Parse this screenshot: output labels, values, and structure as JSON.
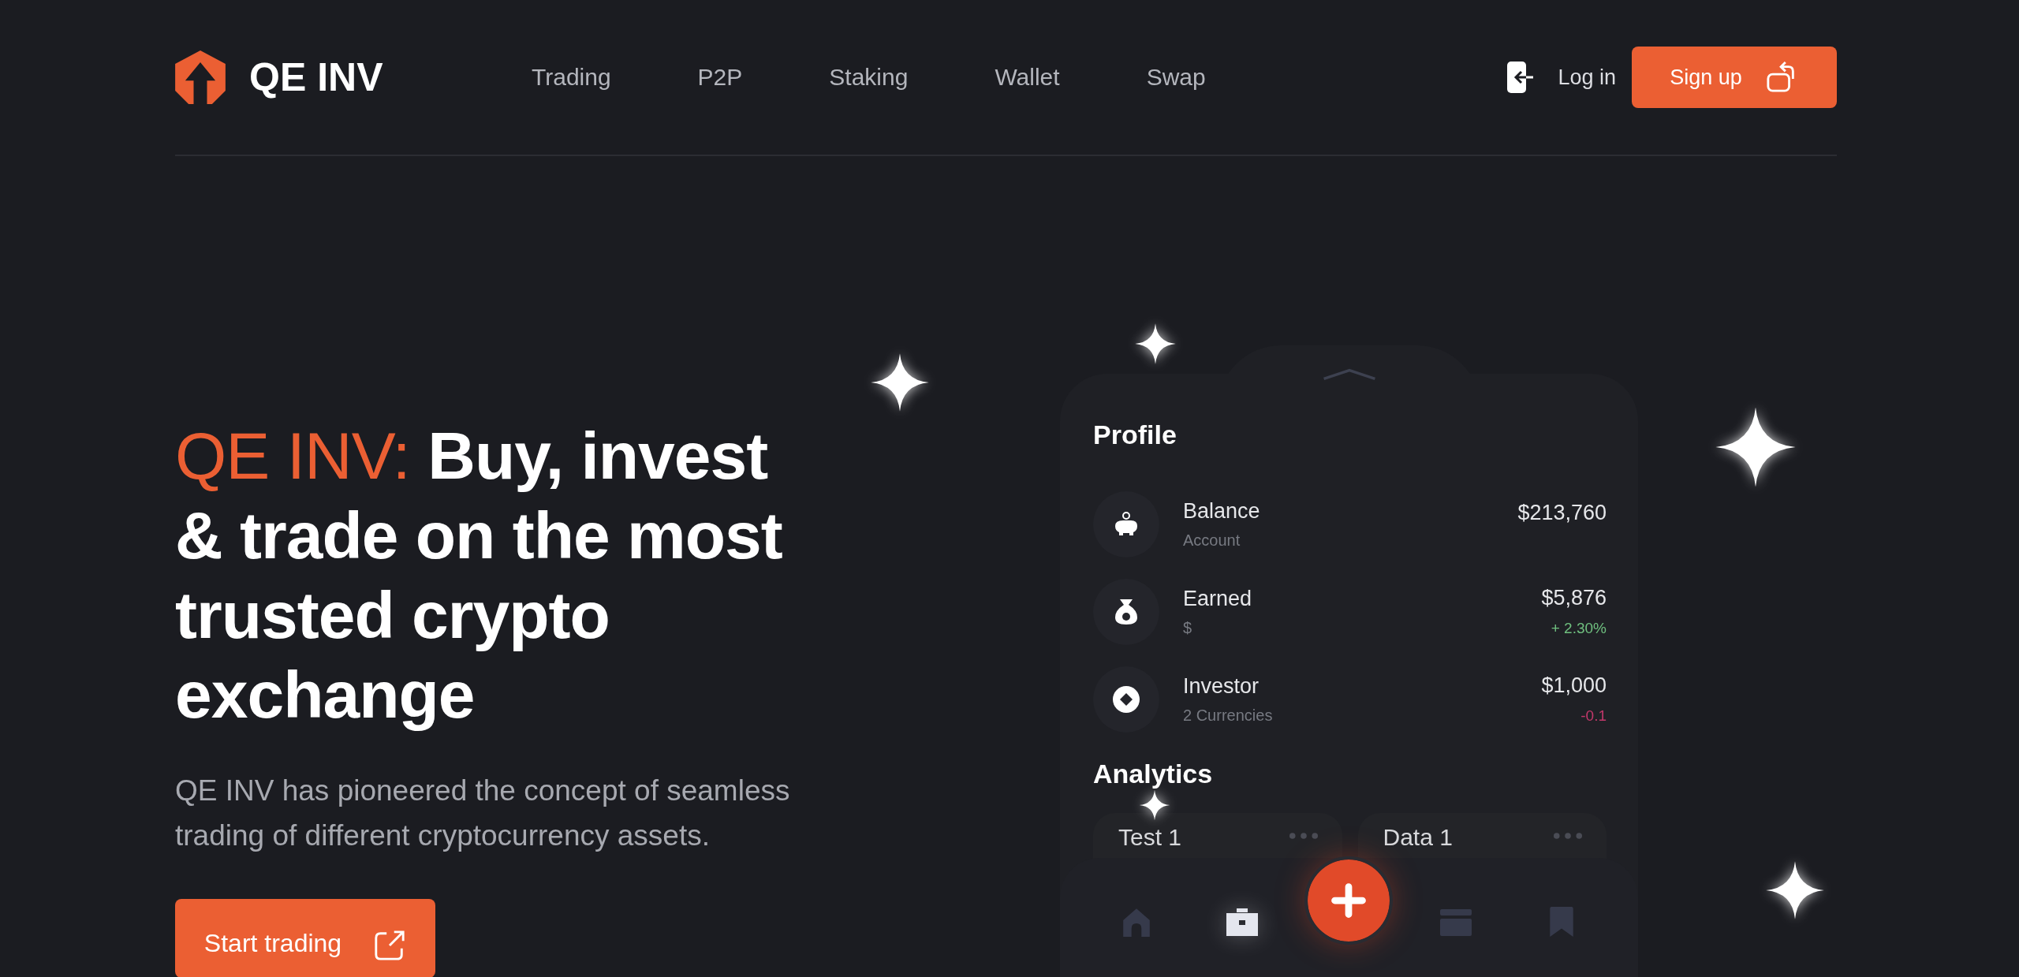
{
  "header": {
    "logo": "QE INV",
    "links": [
      {
        "label": "Trading"
      },
      {
        "label": "P2P"
      },
      {
        "label": "Staking"
      },
      {
        "label": "Wallet"
      },
      {
        "label": "Swap"
      }
    ],
    "login": "Log in",
    "signup": "Sign up"
  },
  "hero": {
    "title_accent": "QE INV:",
    "title": "Buy, invest & trade on the most trusted crypto exchange",
    "text": "QE INV has pioneered the concept of seamless trading of different cryptocurrency assets.",
    "button": "Start trading"
  },
  "app": {
    "profile_title": "Profile",
    "rows": [
      {
        "kind": "piggy",
        "name": "Balance",
        "sub": "Account",
        "value": "$213,760"
      },
      {
        "kind": "bag",
        "name": "Earned",
        "sub": "$",
        "value": "$5,876",
        "change": "+ 2.30%",
        "color": "#6fbf7f"
      },
      {
        "kind": "coin",
        "name": "Investor",
        "sub": "2 Currencies",
        "value": "$1,000",
        "change": "-0.1",
        "color": "#c2386a"
      }
    ],
    "analytics_title": "Analytics",
    "cards": [
      {
        "title": "Test 1"
      },
      {
        "title": "Data 1"
      }
    ],
    "nav": [
      {
        "kind": "home",
        "selected": false
      },
      {
        "kind": "briefcase",
        "selected": true
      },
      {
        "kind": "add",
        "selected": false
      },
      {
        "kind": "card",
        "selected": false
      },
      {
        "kind": "bookmark",
        "selected": false
      }
    ]
  }
}
